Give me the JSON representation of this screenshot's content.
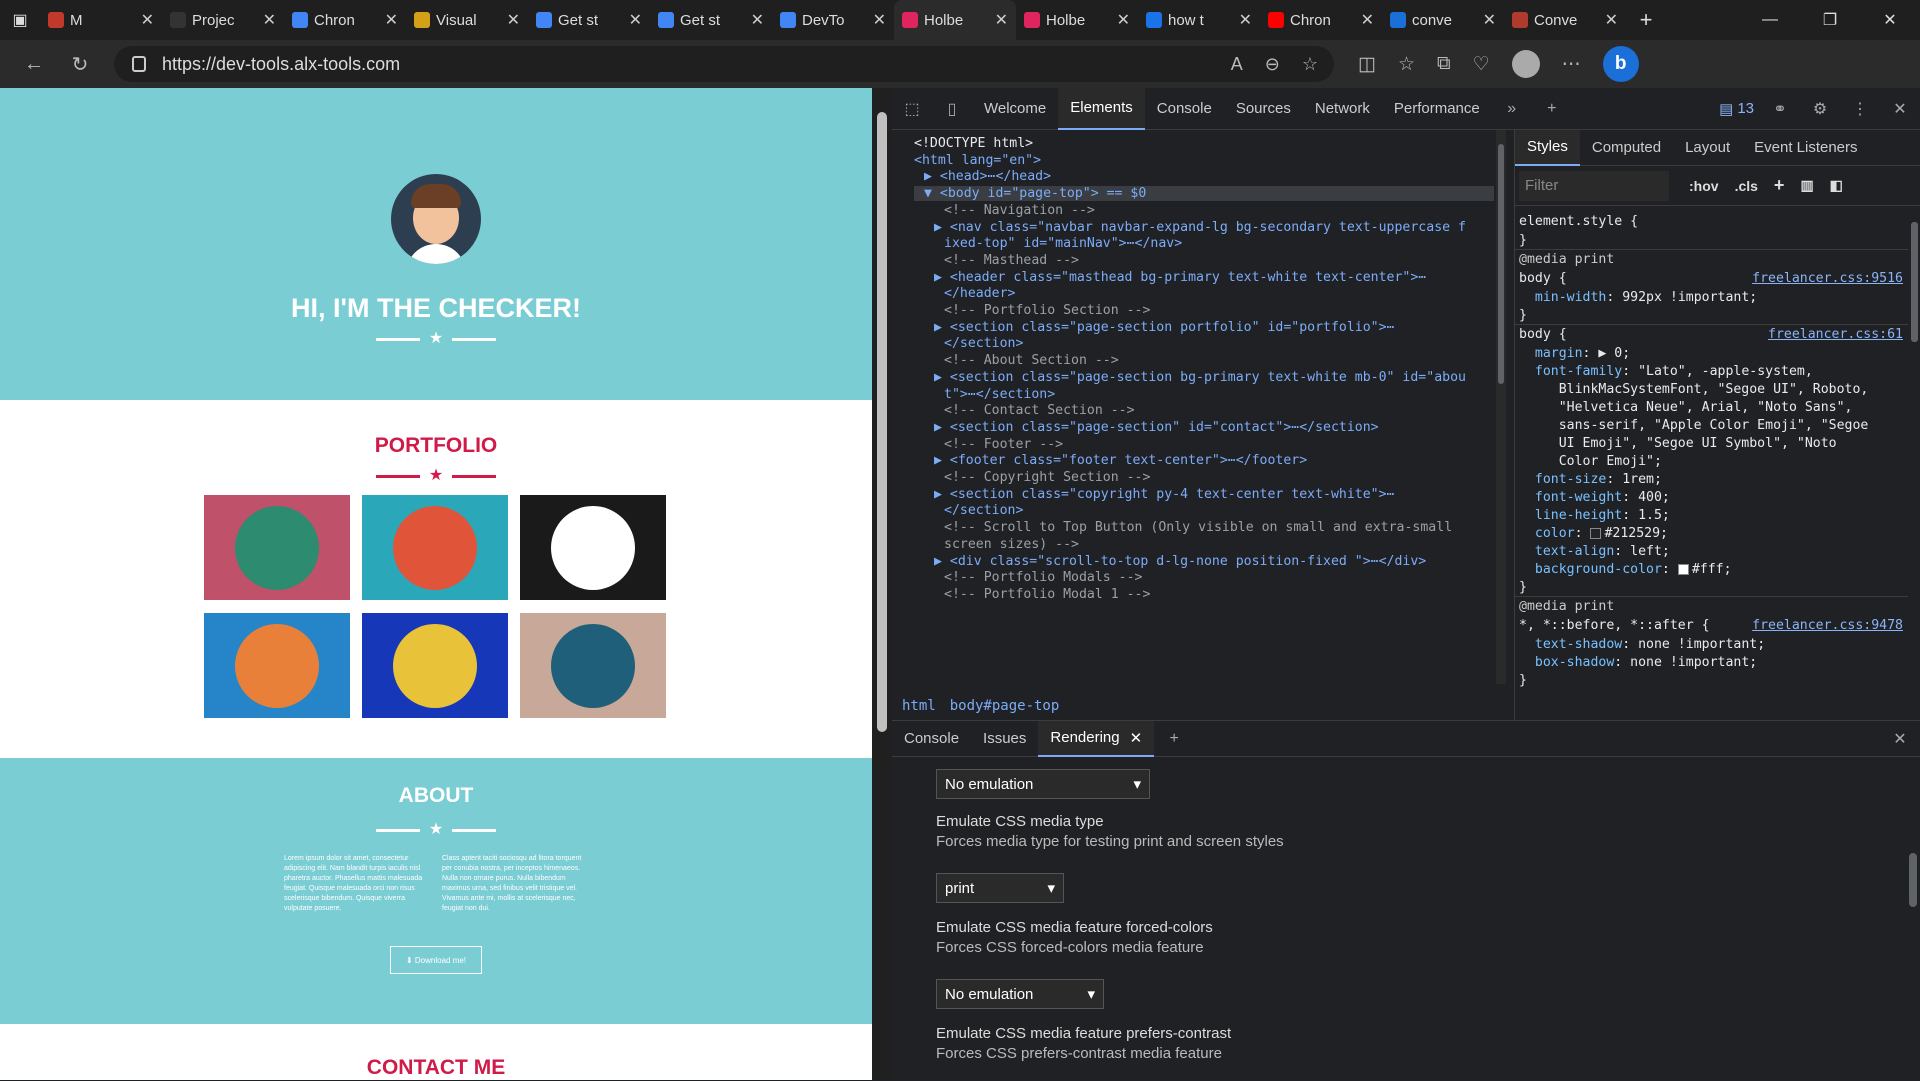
{
  "browser": {
    "tabs": [
      {
        "label": "M",
        "color": "#c0392b"
      },
      {
        "label": "Projec",
        "color": "#333333"
      },
      {
        "label": "Chron",
        "color": "#4285f4"
      },
      {
        "label": "Visual",
        "color": "#d4a017"
      },
      {
        "label": "Get st",
        "color": "#4285f4"
      },
      {
        "label": "Get st",
        "color": "#4285f4"
      },
      {
        "label": "DevTo",
        "color": "#4285f4"
      },
      {
        "label": "Holbe",
        "color": "#e0245e",
        "active": true
      },
      {
        "label": "Holbe",
        "color": "#e0245e"
      },
      {
        "label": "how t",
        "color": "#1a73e8"
      },
      {
        "label": "Chron",
        "color": "#ff0000"
      },
      {
        "label": "conve",
        "color": "#1b6fd8"
      },
      {
        "label": "Conve",
        "color": "#b03a2e"
      }
    ],
    "url": "https://dev-tools.alx-tools.com"
  },
  "page": {
    "masthead_title": "HI, I'M THE CHECKER!",
    "portfolio_title": "PORTFOLIO",
    "about_title": "ABOUT",
    "about_col1": "Lorem ipsum dolor sit amet, consectetur adipiscing elit. Nam blandit turpis iaculis nisl pharetra auctor. Phasellus mattis malesuada feugiat. Quisque malesuada orci non risus scelerisque bibendum. Quisque viverra vulputate posuere.",
    "about_col2": "Class aptent taciti sociosqu ad litora torquent per conubia nostra, per inceptos himenaeos. Nulla non ornare purus. Nulla bibendum maximus urna, sed finibus velit tristique vel. Vivamus ante mi, mollis at scelerisque nec, feugiat non dui.",
    "download_label": "Download me!",
    "contact_title": "CONTACT ME",
    "tiles": [
      {
        "name": "cabin",
        "bg": "#c0516a",
        "circle": "#2d8b6f"
      },
      {
        "name": "cake",
        "bg": "#2aa7b8",
        "circle": "#e0553a"
      },
      {
        "name": "circus",
        "bg": "#1a1a1a",
        "circle": "#ffffff"
      },
      {
        "name": "game",
        "bg": "#2585c8",
        "circle": "#e8803a"
      },
      {
        "name": "safe",
        "bg": "#1638b8",
        "circle": "#e8c239"
      },
      {
        "name": "submarine",
        "bg": "#c8a898",
        "circle": "#1f5f7a"
      }
    ],
    "colors": {
      "primary": "#7bcdd4",
      "secondary": "#d01a48",
      "dark": "#2c3e50"
    }
  },
  "devtools": {
    "tabs": [
      "Welcome",
      "Elements",
      "Console",
      "Sources",
      "Network",
      "Performance"
    ],
    "active_tab": "Elements",
    "issues_count": "13",
    "elements": [
      {
        "indent": 0,
        "text": "<!DOCTYPE html>",
        "kind": "plain"
      },
      {
        "indent": 0,
        "text": "<html lang=\"en\">",
        "kind": "tag"
      },
      {
        "indent": 1,
        "text": "▶ <head>⋯</head>",
        "kind": "tag"
      },
      {
        "indent": 1,
        "text": "▼ <body id=\"page-top\"> == $0",
        "kind": "tag",
        "selected": true
      },
      {
        "indent": 3,
        "text": "<!-- Navigation -->",
        "kind": "cmt"
      },
      {
        "indent": 2,
        "text": "▶ <nav class=\"navbar navbar-expand-lg bg-secondary text-uppercase f",
        "kind": "tag"
      },
      {
        "indent": 3,
        "text": "ixed-top\" id=\"mainNav\">⋯</nav>",
        "kind": "tag"
      },
      {
        "indent": 3,
        "text": "<!-- Masthead -->",
        "kind": "cmt"
      },
      {
        "indent": 2,
        "text": "▶ <header class=\"masthead bg-primary text-white text-center\">⋯",
        "kind": "tag"
      },
      {
        "indent": 3,
        "text": "</header>",
        "kind": "tag"
      },
      {
        "indent": 3,
        "text": "<!-- Portfolio Section -->",
        "kind": "cmt"
      },
      {
        "indent": 2,
        "text": "▶ <section class=\"page-section portfolio\" id=\"portfolio\">⋯",
        "kind": "tag"
      },
      {
        "indent": 3,
        "text": "</section>",
        "kind": "tag"
      },
      {
        "indent": 3,
        "text": "<!-- About Section -->",
        "kind": "cmt"
      },
      {
        "indent": 2,
        "text": "▶ <section class=\"page-section bg-primary text-white mb-0\" id=\"abou",
        "kind": "tag"
      },
      {
        "indent": 3,
        "text": "t\">⋯</section>",
        "kind": "tag"
      },
      {
        "indent": 3,
        "text": "<!-- Contact Section -->",
        "kind": "cmt"
      },
      {
        "indent": 2,
        "text": "▶ <section class=\"page-section\" id=\"contact\">⋯</section>",
        "kind": "tag"
      },
      {
        "indent": 3,
        "text": "<!-- Footer -->",
        "kind": "cmt"
      },
      {
        "indent": 2,
        "text": "▶ <footer class=\"footer text-center\">⋯</footer>",
        "kind": "tag"
      },
      {
        "indent": 3,
        "text": "<!-- Copyright Section -->",
        "kind": "cmt"
      },
      {
        "indent": 2,
        "text": "▶ <section class=\"copyright py-4 text-center text-white\">⋯",
        "kind": "tag"
      },
      {
        "indent": 3,
        "text": "</section>",
        "kind": "tag"
      },
      {
        "indent": 3,
        "text": "<!-- Scroll to Top Button (Only visible on small and extra-small",
        "kind": "cmt"
      },
      {
        "indent": 3,
        "text": "screen sizes) -->",
        "kind": "cmt"
      },
      {
        "indent": 2,
        "text": "▶ <div class=\"scroll-to-top d-lg-none position-fixed \">⋯</div>",
        "kind": "tag"
      },
      {
        "indent": 3,
        "text": "<!-- Portfolio Modals -->",
        "kind": "cmt"
      },
      {
        "indent": 3,
        "text": "<!-- Portfolio Modal 1 -->",
        "kind": "cmt"
      }
    ],
    "breadcrumbs": [
      "html",
      "body#page-top"
    ],
    "styles_tabs": [
      "Styles",
      "Computed",
      "Layout",
      "Event Listeners"
    ],
    "filter_placeholder": "Filter",
    "hov": ":hov",
    "cls": ".cls",
    "styles": [
      {
        "text": "element.style {",
        "kind": "sel"
      },
      {
        "text": "}",
        "kind": "sel"
      },
      {
        "text": "@media print",
        "kind": "media"
      },
      {
        "text": "body {",
        "kind": "sel",
        "link": "freelancer.css:9516"
      },
      {
        "text": "  min-width: 992px !important;",
        "kind": "prop"
      },
      {
        "text": "}",
        "kind": "sel"
      },
      {
        "text": "body {",
        "kind": "sel",
        "link": "freelancer.css:61"
      },
      {
        "text": "  margin: ▶ 0;",
        "kind": "prop"
      },
      {
        "text": "  font-family: \"Lato\", -apple-system,",
        "kind": "prop"
      },
      {
        "text": "     BlinkMacSystemFont, \"Segoe UI\", Roboto,",
        "kind": "val"
      },
      {
        "text": "     \"Helvetica Neue\", Arial, \"Noto Sans\",",
        "kind": "val"
      },
      {
        "text": "     sans-serif, \"Apple Color Emoji\", \"Segoe",
        "kind": "val"
      },
      {
        "text": "     UI Emoji\", \"Segoe UI Symbol\", \"Noto",
        "kind": "val"
      },
      {
        "text": "     Color Emoji\";",
        "kind": "val"
      },
      {
        "text": "  font-size: 1rem;",
        "kind": "prop"
      },
      {
        "text": "  font-weight: 400;",
        "kind": "prop"
      },
      {
        "text": "  line-height: 1.5;",
        "kind": "prop"
      },
      {
        "text": "  color: #212529;",
        "kind": "prop",
        "swatch": "#212529"
      },
      {
        "text": "  text-align: left;",
        "kind": "prop"
      },
      {
        "text": "  background-color: #fff;",
        "kind": "prop",
        "swatch": "#ffffff"
      },
      {
        "text": "}",
        "kind": "sel"
      },
      {
        "text": "@media print",
        "kind": "media"
      },
      {
        "text": "*, *::before, *::after {",
        "kind": "sel",
        "link": "freelancer.css:9478"
      },
      {
        "text": "  text-shadow: none !important;",
        "kind": "prop"
      },
      {
        "text": "  box-shadow: none !important;",
        "kind": "prop"
      },
      {
        "text": "}",
        "kind": "sel"
      }
    ],
    "drawer_tabs": [
      "Console",
      "Issues",
      "Rendering"
    ],
    "drawer_active": "Rendering",
    "rendering": {
      "select1": "No emulation",
      "media_type_title": "Emulate CSS media type",
      "media_type_desc": "Forces media type for testing print and screen styles",
      "media_type_value": "print",
      "forced_colors_title": "Emulate CSS media feature forced-colors",
      "forced_colors_desc": "Forces CSS forced-colors media feature",
      "forced_colors_value": "No emulation",
      "contrast_title": "Emulate CSS media feature prefers-contrast",
      "contrast_desc": "Forces CSS prefers-contrast media feature"
    }
  }
}
